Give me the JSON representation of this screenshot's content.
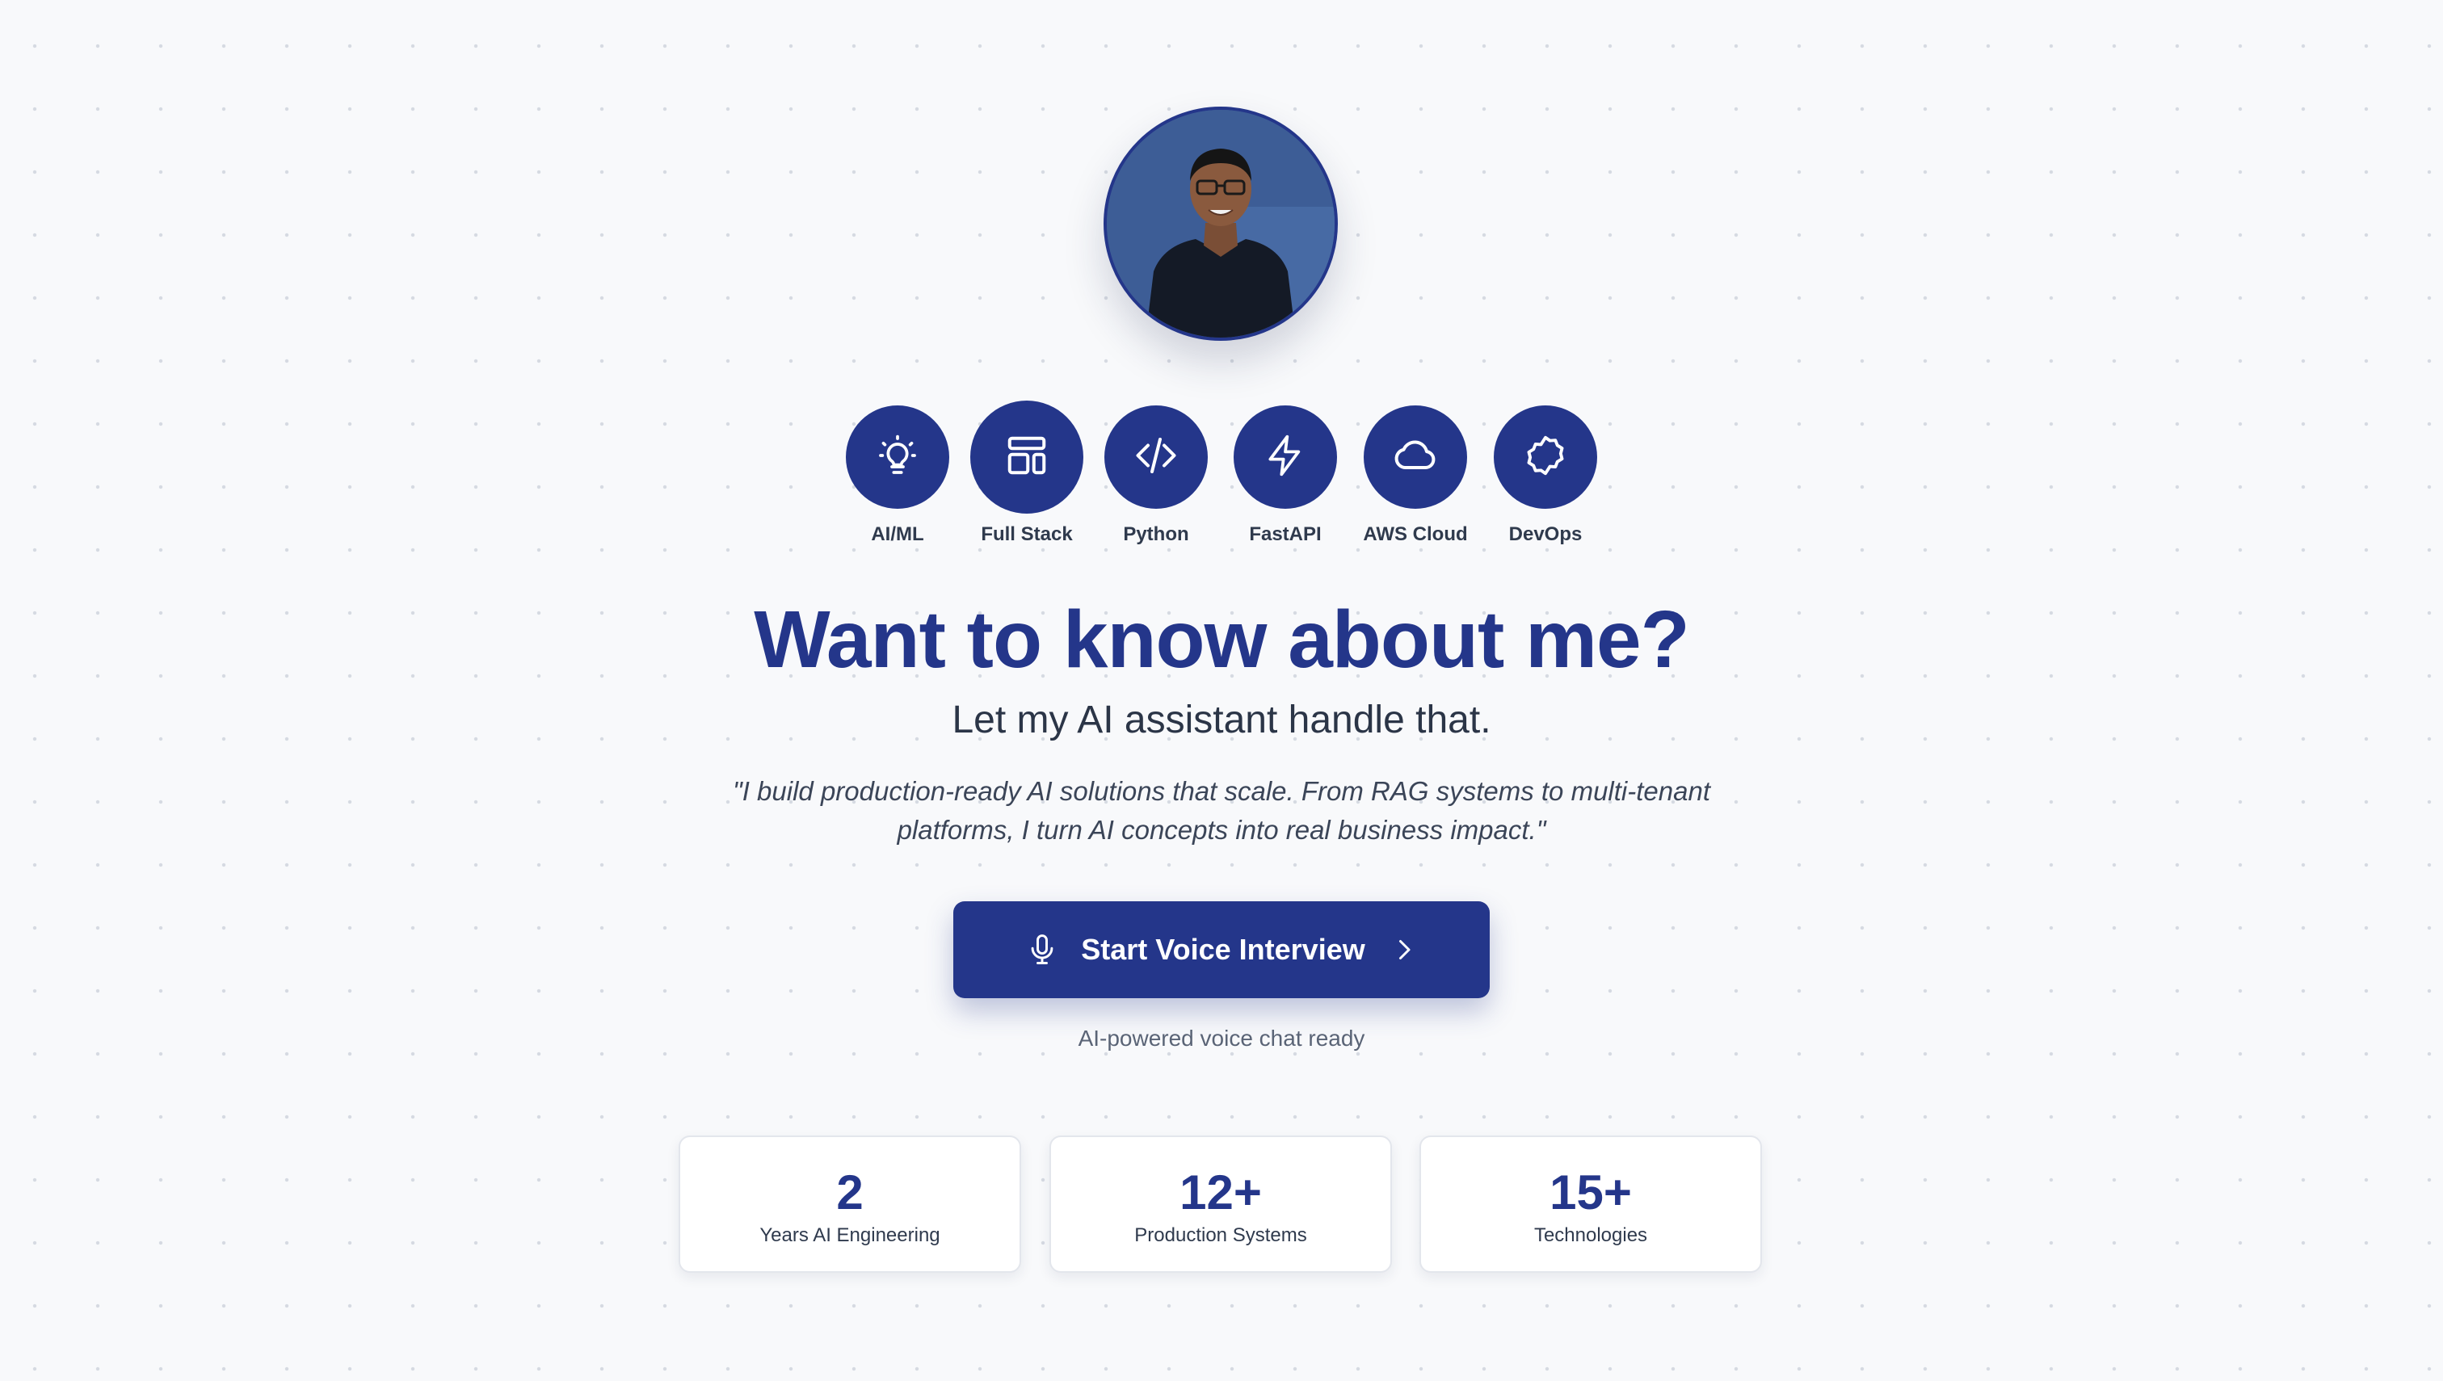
{
  "skills": [
    {
      "label": "AI/ML",
      "icon": "lightbulb-icon"
    },
    {
      "label": "Full Stack",
      "icon": "layout-icon"
    },
    {
      "label": "Python",
      "icon": "code-icon"
    },
    {
      "label": "FastAPI",
      "icon": "lightning-icon"
    },
    {
      "label": "AWS Cloud",
      "icon": "cloud-icon"
    },
    {
      "label": "DevOps",
      "icon": "gear-icon"
    }
  ],
  "hero": {
    "title": "Want to know about me?",
    "subtitle": "Let my AI assistant handle that.",
    "quote": "\"I build production-ready AI solutions that scale. From RAG systems to multi-tenant platforms, I turn AI concepts into real business impact.\""
  },
  "cta": {
    "label": "Start Voice Interview",
    "icon": "microphone-icon",
    "trailing_icon": "chevron-right-icon"
  },
  "status": "AI-powered voice chat ready",
  "stats": [
    {
      "value": "2",
      "label": "Years AI Engineering"
    },
    {
      "value": "12+",
      "label": "Production Systems"
    },
    {
      "value": "15+",
      "label": "Technologies"
    }
  ],
  "colors": {
    "accent": "#24368a",
    "background": "#f8f9fb",
    "text": "#2f3a4d",
    "muted": "#5a6476"
  }
}
